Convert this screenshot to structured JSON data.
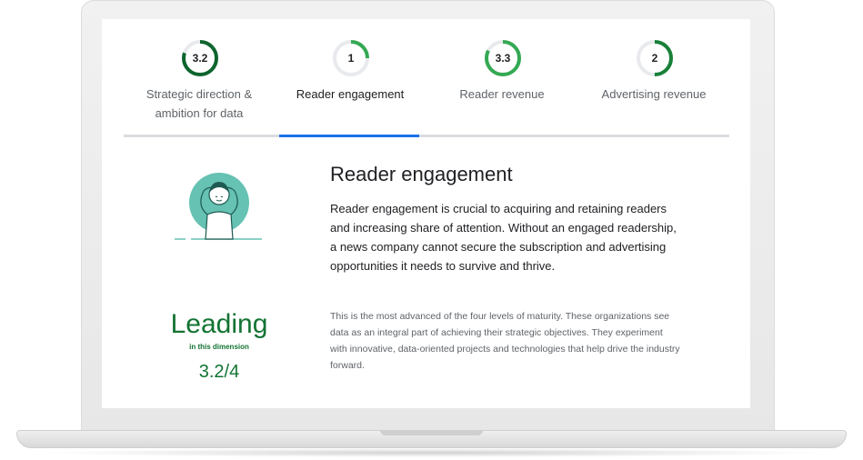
{
  "tabs": [
    {
      "score": "3.2",
      "label": "Strategic direction & ambition for data",
      "progress": 0.8,
      "color": "#0d652d"
    },
    {
      "score": "1",
      "label": "Reader engagement",
      "progress": 0.25,
      "color": "#34a853",
      "active": true
    },
    {
      "score": "3.3",
      "label": "Reader revenue",
      "progress": 0.825,
      "color": "#34a853"
    },
    {
      "score": "2",
      "label": "Advertising revenue",
      "progress": 0.5,
      "color": "#188038"
    }
  ],
  "section": {
    "illustration_icon": "reader-relaxing-illustration",
    "title": "Reader engagement",
    "description": "Reader engagement is crucial to acquiring and retaining readers and increasing share of attention. Without an engaged readership, a news company cannot secure the subscription and advertising opportunities it needs to survive and thrive."
  },
  "maturity": {
    "level": "Leading",
    "subtitle": "in this dimension",
    "score": "3.2/4",
    "description": "This is the most advanced of the four levels of maturity. These organizations see data as an integral part of achieving their strategic objectives. They experiment with innovative, data-oriented projects and technologies that help drive the industry forward."
  },
  "colors": {
    "accent": "#1a73e8",
    "leading_green": "#137333",
    "illustration_teal": "#66c2b3"
  }
}
